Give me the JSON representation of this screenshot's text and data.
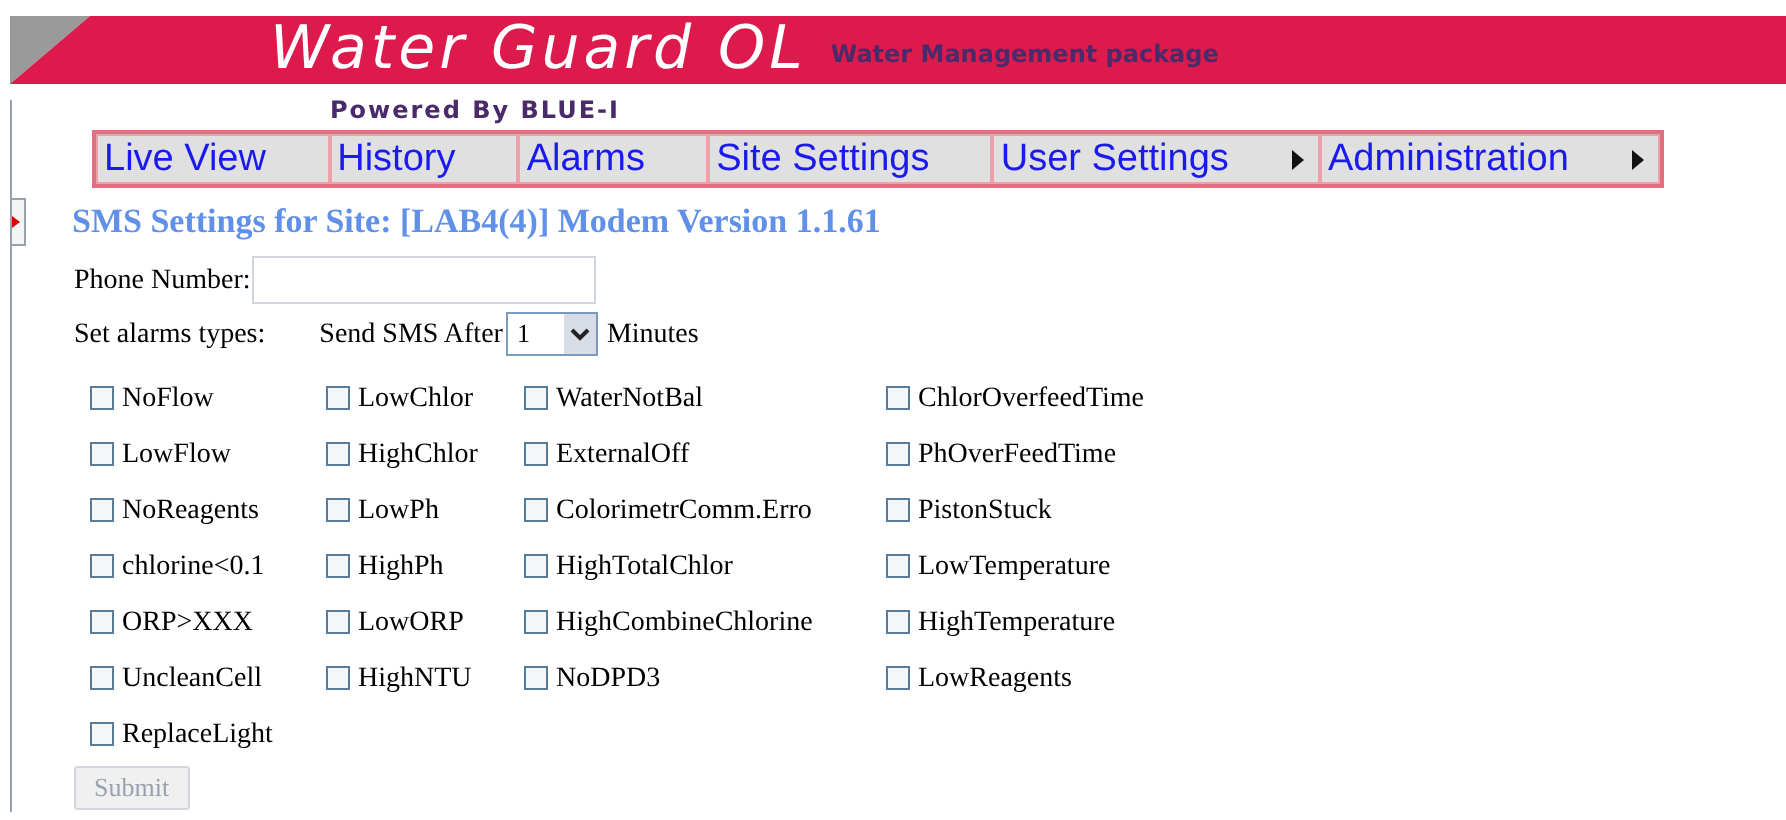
{
  "header": {
    "title": "Water Guard OL",
    "subtitle": "Water Management package",
    "powered_by": "Powered By BLUE-I"
  },
  "nav": [
    {
      "label": "Live View",
      "submenu": false
    },
    {
      "label": "History",
      "submenu": false
    },
    {
      "label": "Alarms",
      "submenu": false
    },
    {
      "label": "Site Settings",
      "submenu": false
    },
    {
      "label": "User Settings",
      "submenu": true
    },
    {
      "label": "Administration",
      "submenu": true
    }
  ],
  "page_title": "SMS Settings for Site: [LAB4(4)] Modem Version 1.1.61",
  "phone": {
    "label": "Phone Number:"
  },
  "alarms_label": "Set alarms types:",
  "send_after": {
    "label": "Send SMS After",
    "value": "1",
    "unit": "Minutes"
  },
  "alarm_types": [
    {
      "label": "NoFlow",
      "checked": false
    },
    {
      "label": "LowChlor",
      "checked": false
    },
    {
      "label": "WaterNotBal",
      "checked": false
    },
    {
      "label": "ChlorOverfeedTime",
      "checked": false
    },
    {
      "label": "LowFlow",
      "checked": false
    },
    {
      "label": "HighChlor",
      "checked": false
    },
    {
      "label": "ExternalOff",
      "checked": false
    },
    {
      "label": "PhOverFeedTime",
      "checked": false
    },
    {
      "label": "NoReagents",
      "checked": false
    },
    {
      "label": "LowPh",
      "checked": false
    },
    {
      "label": "ColorimetrComm.Erro",
      "checked": false
    },
    {
      "label": "PistonStuck",
      "checked": false
    },
    {
      "label": "chlorine<0.1",
      "checked": false
    },
    {
      "label": "HighPh",
      "checked": false
    },
    {
      "label": "HighTotalChlor",
      "checked": false
    },
    {
      "label": "LowTemperature",
      "checked": false
    },
    {
      "label": "ORP>XXX",
      "checked": false
    },
    {
      "label": "LowORP",
      "checked": false
    },
    {
      "label": "HighCombineChlorine",
      "checked": false
    },
    {
      "label": "HighTemperature",
      "checked": false
    },
    {
      "label": "UncleanCell",
      "checked": false
    },
    {
      "label": "HighNTU",
      "checked": false
    },
    {
      "label": "NoDPD3",
      "checked": false
    },
    {
      "label": "LowReagents",
      "checked": false
    },
    {
      "label": "ReplaceLight",
      "checked": false
    }
  ],
  "submit": {
    "label": "Submit",
    "disabled": true
  }
}
